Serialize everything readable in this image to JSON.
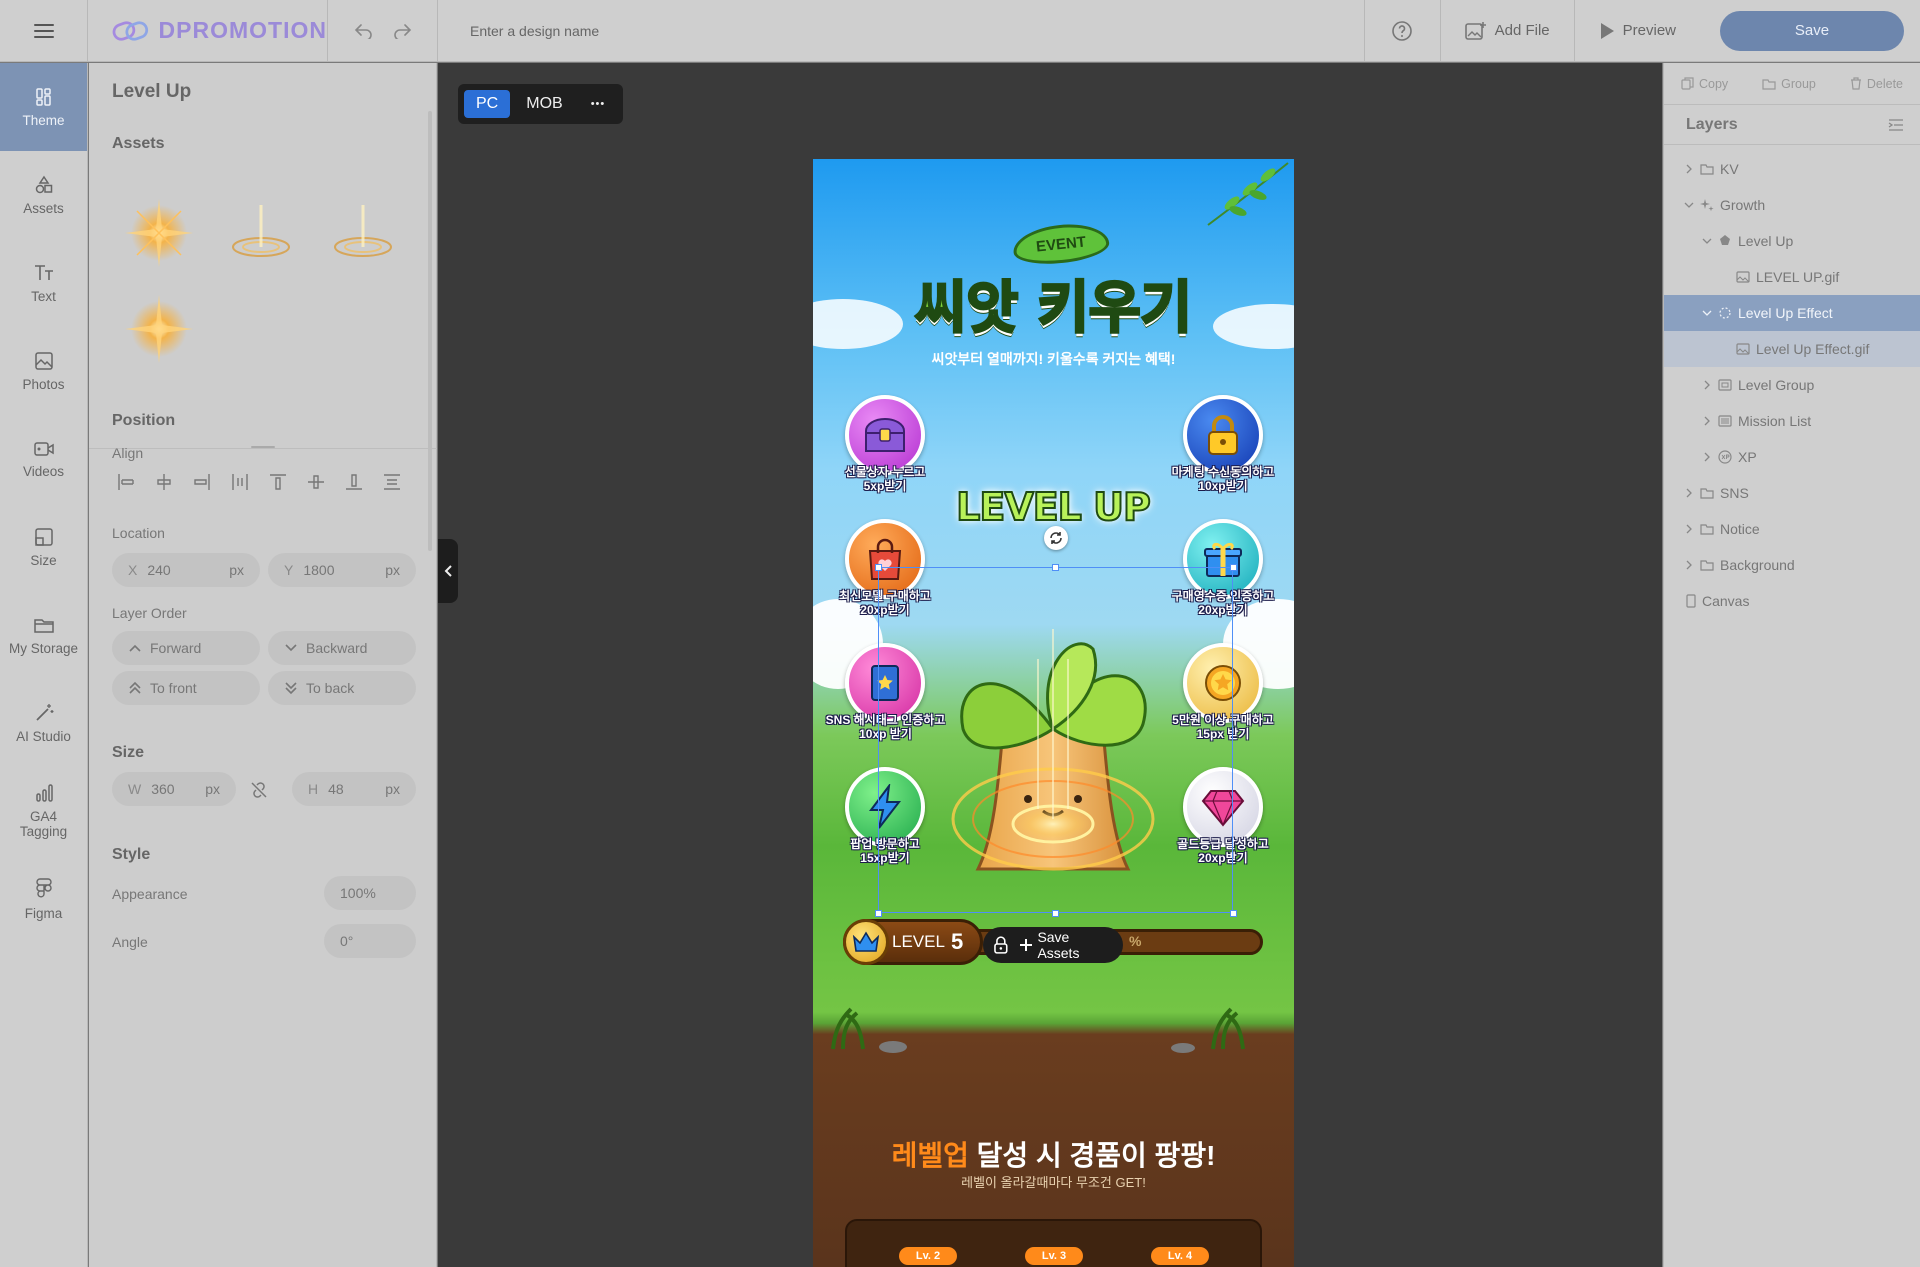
{
  "topbar": {
    "logo": "DPROMOTION",
    "design_name_placeholder": "Enter a design name",
    "add_file": "Add File",
    "preview": "Preview",
    "save": "Save"
  },
  "leftnav": {
    "items": [
      {
        "label": "Theme",
        "icon": "theme-icon",
        "active": true
      },
      {
        "label": "Assets",
        "icon": "shapes-icon"
      },
      {
        "label": "Text",
        "icon": "text-icon"
      },
      {
        "label": "Photos",
        "icon": "photo-icon"
      },
      {
        "label": "Videos",
        "icon": "video-icon"
      },
      {
        "label": "Size",
        "icon": "size-icon"
      },
      {
        "label": "My Storage",
        "icon": "folder-icon"
      },
      {
        "label": "AI Studio",
        "icon": "magic-wand-icon"
      },
      {
        "label": "GA4 Tagging",
        "icon": "analytics-icon"
      },
      {
        "label": "Figma",
        "icon": "figma-icon"
      }
    ]
  },
  "leftpanel": {
    "title": "Level Up",
    "assets_heading": "Assets",
    "position_heading": "Position",
    "align_label": "Align",
    "location_label": "Location",
    "x_label": "X",
    "x_value": "240",
    "x_unit": "px",
    "y_label": "Y",
    "y_value": "1800",
    "y_unit": "px",
    "layer_order_label": "Layer Order",
    "forward": "Forward",
    "backward": "Backward",
    "to_front": "To front",
    "to_back": "To back",
    "size_heading": "Size",
    "w_label": "W",
    "w_value": "360",
    "w_unit": "px",
    "h_label": "H",
    "h_value": "48",
    "h_unit": "px",
    "style_heading": "Style",
    "appearance_label": "Appearance",
    "appearance_value": "100%",
    "angle_label": "Angle",
    "angle_value": "0°"
  },
  "canvas": {
    "pc": "PC",
    "mob": "MOB",
    "more": "•••"
  },
  "design": {
    "event_badge": "EVENT",
    "title": "씨앗 키우기",
    "subtitle": "씨앗부터 열매까지! 키울수록 커지는 혜택!",
    "missions_left": [
      {
        "line1": "선물상자 누르고",
        "line2": "5xp받기",
        "color": "#c64ae0",
        "icon": "treasure-chest-icon"
      },
      {
        "line1": "최신모델 구매하고",
        "line2": "20xp받기",
        "color": "#f07a1a",
        "icon": "shopping-bag-icon"
      },
      {
        "line1": "SNS 해시태그 인증하고",
        "line2": "10xp 받기",
        "color": "#e83fb8",
        "icon": "book-icon"
      },
      {
        "line1": "팝업 방문하고",
        "line2": "15xp받기",
        "color": "#2fc65a",
        "icon": "lightning-icon"
      }
    ],
    "missions_right": [
      {
        "line1": "마케팅 수신동의하고",
        "line2": "10xp받기",
        "color": "#1f5fe0",
        "icon": "padlock-icon"
      },
      {
        "line1": "구매영수증 인증하고",
        "line2": "20xp받기",
        "color": "#23c1c8",
        "icon": "gift-icon"
      },
      {
        "line1": "5만원 이상 구매하고",
        "line2": "15px 받기",
        "color": "#f3c94b",
        "icon": "star-coin-icon"
      },
      {
        "line1": "골드등급 달성하고",
        "line2": "20xp받기",
        "color": "#e7e7ee",
        "icon": "gem-icon"
      }
    ],
    "level_up_text": "LEVEL UP",
    "level_label": "LEVEL",
    "level_number": "5",
    "xp_partial": "%",
    "save_assets": "Save Assets",
    "bottom_title_highlight": "레벨업",
    "bottom_title_rest": " 달성 시 경품이 팡팡!",
    "bottom_subtitle": "레벨이 올라갈때마다 무조건 GET!",
    "levels": [
      "Lv. 2",
      "Lv. 3",
      "Lv. 4"
    ]
  },
  "rightpanel": {
    "copy": "Copy",
    "group": "Group",
    "delete": "Delete",
    "layers_heading": "Layers",
    "layers": [
      {
        "label": "KV",
        "indent": 0,
        "kind": "folder",
        "chev": "right"
      },
      {
        "label": "Growth",
        "indent": 0,
        "kind": "sparkle",
        "chev": "down"
      },
      {
        "label": "Level Up",
        "indent": 1,
        "kind": "shape",
        "chev": "down"
      },
      {
        "label": "LEVEL UP.gif",
        "indent": 2,
        "kind": "image",
        "chev": ""
      },
      {
        "label": "Level Up Effect",
        "indent": 1,
        "kind": "effect",
        "chev": "down",
        "selected": true
      },
      {
        "label": "Level Up Effect.gif",
        "indent": 2,
        "kind": "image",
        "chev": "",
        "selected_child": true
      },
      {
        "label": "Level Group",
        "indent": 1,
        "kind": "group",
        "chev": "right"
      },
      {
        "label": "Mission List",
        "indent": 1,
        "kind": "list",
        "chev": "right"
      },
      {
        "label": "XP",
        "indent": 1,
        "kind": "xp",
        "chev": "right"
      },
      {
        "label": "SNS",
        "indent": 0,
        "kind": "folder",
        "chev": "right"
      },
      {
        "label": "Notice",
        "indent": 0,
        "kind": "folder",
        "chev": "right"
      },
      {
        "label": "Background",
        "indent": 0,
        "kind": "folder",
        "chev": "right"
      },
      {
        "label": "Canvas",
        "indent": 0,
        "kind": "canvas",
        "chev": ""
      }
    ]
  }
}
